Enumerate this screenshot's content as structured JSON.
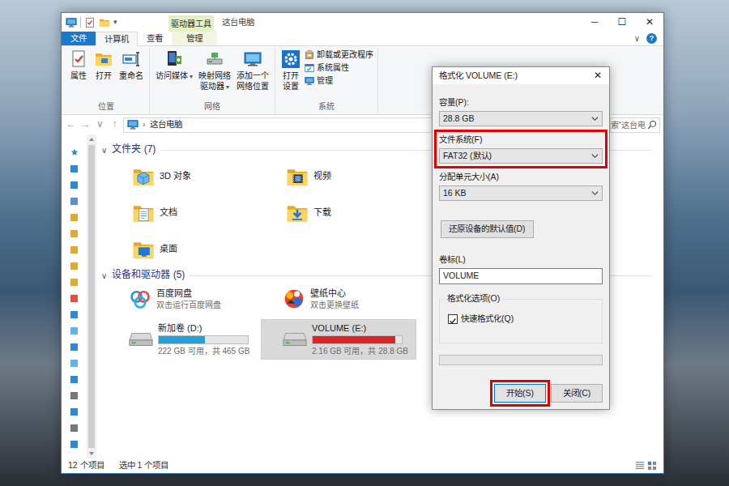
{
  "explorer": {
    "title": "这台电脑",
    "quick_access_caret": "▾",
    "context_group": "驱动器工具",
    "window_controls": [
      "─",
      "☐",
      "✕"
    ],
    "tabs": [
      {
        "label": "文件",
        "kind": "file",
        "selected": false
      },
      {
        "label": "计算机",
        "kind": "normal",
        "selected": true
      },
      {
        "label": "查看",
        "kind": "normal",
        "selected": false
      },
      {
        "label": "管理",
        "kind": "context",
        "selected": false
      }
    ],
    "ribbon_toggle": "∨",
    "help": "?",
    "ribbon_groups": [
      {
        "label": "位置",
        "buttons": [
          {
            "lines": [
              "属性"
            ]
          },
          {
            "lines": [
              "打开"
            ]
          },
          {
            "lines": [
              "重命名"
            ]
          }
        ],
        "small": []
      },
      {
        "label": "网络",
        "buttons": [
          {
            "lines": [
              "访问媒体"
            ],
            "caret": "▾"
          },
          {
            "lines": [
              "映射网络",
              "驱动器"
            ],
            "caret": "▾"
          },
          {
            "lines": [
              "添加一个",
              "网络位置"
            ]
          }
        ],
        "small": []
      },
      {
        "label": "系统",
        "buttons": [
          {
            "lines": [
              "打开",
              "设置"
            ]
          }
        ],
        "small": [
          "卸载或更改程序",
          "系统属性",
          "管理"
        ]
      }
    ],
    "nav_buttons": [
      "←",
      "→",
      "∨",
      "↑"
    ],
    "address": {
      "separator": "›",
      "path": "这台电脑"
    },
    "search": {
      "text": "索“这台电"
    },
    "sections": [
      {
        "toggle": "∨",
        "title": "文件夹 (7)",
        "items": [
          {
            "kind": "folder",
            "name": "3D 对象",
            "selected": false
          },
          {
            "kind": "folder",
            "name": "视频",
            "selected": false
          },
          {
            "kind": "folder",
            "name": "文档",
            "selected": false
          },
          {
            "kind": "folder",
            "name": "下载",
            "selected": false
          },
          {
            "kind": "folder",
            "name": "桌面",
            "selected": false
          }
        ]
      },
      {
        "toggle": "∨",
        "title": "设备和驱动器 (5)",
        "items": [
          {
            "kind": "app",
            "name": "百度网盘",
            "subtitle": "双击运行百度网盘",
            "selected": false
          },
          {
            "kind": "app",
            "name": "壁纸中心",
            "subtitle": "双击更换壁纸",
            "selected": false
          },
          {
            "kind": "drive",
            "name": "新加卷 (D:)",
            "detail": "222 GB 可用，共 465 GB",
            "level": 0.52,
            "color": "#26a0da",
            "selected": false
          },
          {
            "kind": "drive",
            "name": "VOLUME (E:)",
            "detail": "2.16 GB 可用，共 28.8 GB",
            "level": 0.925,
            "color": "#da2626",
            "selected": true
          }
        ]
      }
    ],
    "status_bar": {
      "count": "12 个项目",
      "selection": "选中 1 个项目"
    }
  },
  "dialog": {
    "title": "格式化 VOLUME (E:)",
    "close": "✕",
    "fields": [
      {
        "label": "容量(P):",
        "value": "28.8 GB",
        "annotated": false
      },
      {
        "label": "文件系统(F)",
        "value": "FAT32 (默认)",
        "annotated": true
      },
      {
        "label": "分配单元大小(A)",
        "value": "16 KB",
        "annotated": false
      }
    ],
    "restore_button": "还原设备的默认值(D)",
    "volume_label": {
      "label": "卷标(L)",
      "value": "VOLUME"
    },
    "options": {
      "label": "格式化选项(O)",
      "items": [
        {
          "label": "快速格式化(Q)",
          "checked": true
        }
      ]
    },
    "progress": {
      "level": 0
    },
    "buttons": [
      {
        "label": "开始(S)",
        "annotated": true
      },
      {
        "label": "关闭(C)",
        "annotated": false
      }
    ]
  }
}
